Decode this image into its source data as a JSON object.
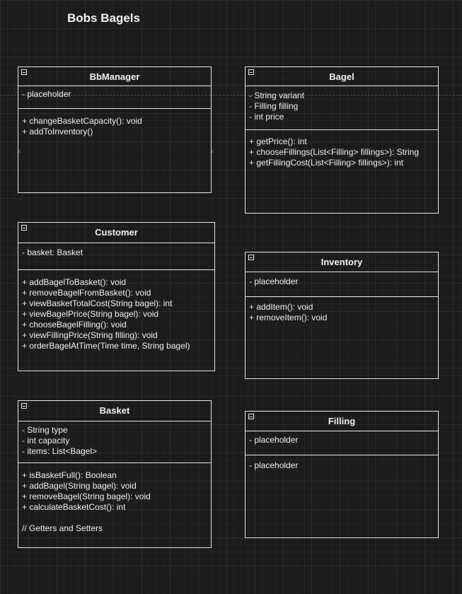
{
  "diagram": {
    "title": "Bobs Bagels",
    "classes": {
      "bbmanager": {
        "name": "BbManager",
        "attributes": [
          "- placeholder"
        ],
        "methods": [
          "+ changeBasketCapacity(): void",
          "+ addToInventory()"
        ]
      },
      "bagel": {
        "name": "Bagel",
        "attributes": [
          "- String variant",
          "- Filling filling",
          "- int price"
        ],
        "methods": [
          "+ getPrice(): int",
          "+ chooseFillings(List<Filling> fillings>): String",
          "+ getFillingCost(List<Filling> fillings>): int"
        ]
      },
      "customer": {
        "name": "Customer",
        "attributes": [
          "- basket: Basket"
        ],
        "methods": [
          "+ addBagelToBasket(): void",
          "+ removeBagelFromBasket(): void",
          "+ viewBasketTotalCost(String bagel): int",
          "+ viewBagelPrice(String bagel): void",
          "+ chooseBagelFilling(): void",
          "+ viewFillingPrice(String filling): void",
          "+ orderBagelAtTime(Time time, String bagel)"
        ]
      },
      "inventory": {
        "name": "Inventory",
        "attributes": [
          "- placeholder"
        ],
        "methods": [
          "+ addItem(): void",
          "+ removeItem(): void"
        ]
      },
      "basket": {
        "name": "Basket",
        "attributes": [
          "- String type",
          "- int capacity",
          "- items: List<Bagel>"
        ],
        "methods": [
          "+ isBasketFull(): Boolean",
          "+ addBagel(String bagel): void",
          "+ removeBagel(String bagel): void",
          "+ calculateBasketCost(): int",
          "",
          "// Getters and Setters"
        ]
      },
      "filling": {
        "name": "Filling",
        "attributes": [
          "- placeholder"
        ],
        "methods": [
          "- placeholder"
        ]
      }
    }
  }
}
